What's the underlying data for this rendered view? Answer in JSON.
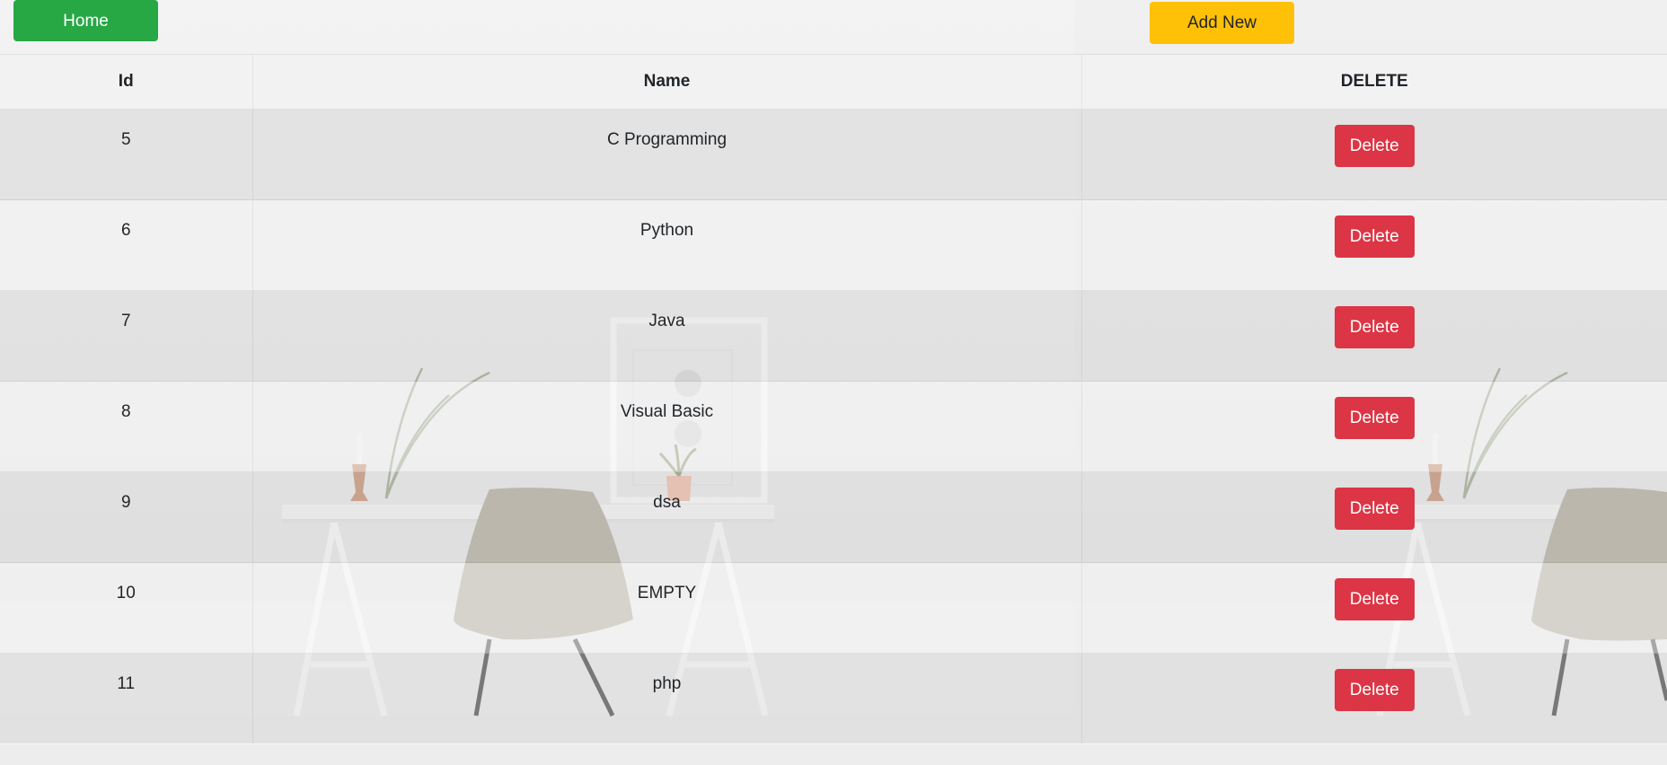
{
  "nav": {
    "home_label": "Home",
    "add_new_label": "Add New"
  },
  "table": {
    "headers": {
      "id": "Id",
      "name": "Name",
      "delete": "DELETE"
    },
    "delete_label": "Delete",
    "rows": [
      {
        "id": "5",
        "name": "C Programming"
      },
      {
        "id": "6",
        "name": "Python"
      },
      {
        "id": "7",
        "name": "Java"
      },
      {
        "id": "8",
        "name": "Visual Basic"
      },
      {
        "id": "9",
        "name": "dsa"
      },
      {
        "id": "10",
        "name": "EMPTY"
      },
      {
        "id": "11",
        "name": "php"
      }
    ]
  },
  "colors": {
    "home": "#28a745",
    "add_new": "#ffc107",
    "delete": "#dc3545"
  }
}
